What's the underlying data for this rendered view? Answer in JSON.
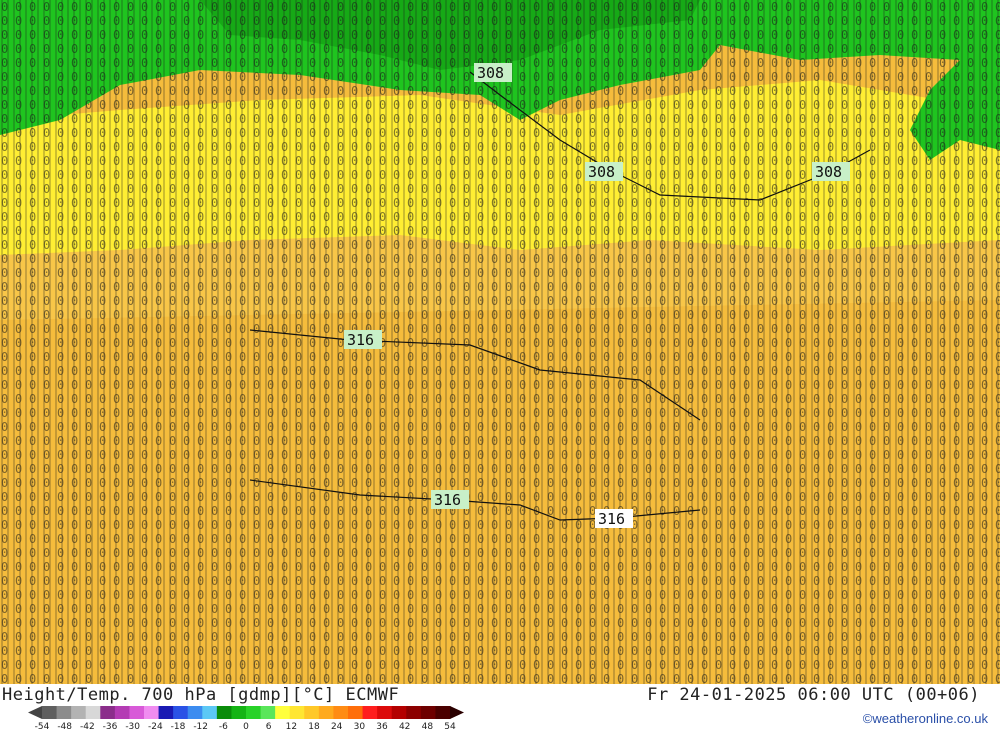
{
  "map": {
    "contour_labels": [
      {
        "text": "308"
      },
      {
        "text": "308"
      },
      {
        "text": "308"
      },
      {
        "text": "316"
      },
      {
        "text": "316"
      },
      {
        "text": "316"
      }
    ],
    "regions": [
      {
        "name": "green-north",
        "color": "#1fc41f"
      },
      {
        "name": "yellow-band",
        "color": "#ffee33"
      },
      {
        "name": "orange-south",
        "color": "#f5bc3c"
      }
    ]
  },
  "footer": {
    "title": "Height/Temp. 700 hPa [gdmp][°C] ECMWF",
    "datetime": "Fr 24-01-2025 06:00 UTC (00+06)",
    "credit": "©weatheronline.co.uk"
  },
  "legend": {
    "ticks": [
      "-54",
      "-48",
      "-42",
      "-36",
      "-30",
      "-24",
      "-18",
      "-12",
      "-6",
      "0",
      "6",
      "12",
      "18",
      "24",
      "30",
      "36",
      "42",
      "48",
      "54"
    ],
    "colors": [
      "#5f5f5f",
      "#8c8c8c",
      "#b3b3b3",
      "#d8d8d8",
      "#8b2e8b",
      "#b43cb4",
      "#d85ad8",
      "#f08cf0",
      "#1a1ab4",
      "#2a52e6",
      "#3c8cf0",
      "#5cc8f5",
      "#0a8c0a",
      "#14b414",
      "#28d228",
      "#5ae65a",
      "#ffff3c",
      "#ffe632",
      "#ffc828",
      "#ffaa1e",
      "#ff8c14",
      "#ff6e0a",
      "#ff1e1e",
      "#dc0a0a",
      "#b40000",
      "#8c0000",
      "#6e0000",
      "#4b0000"
    ]
  }
}
